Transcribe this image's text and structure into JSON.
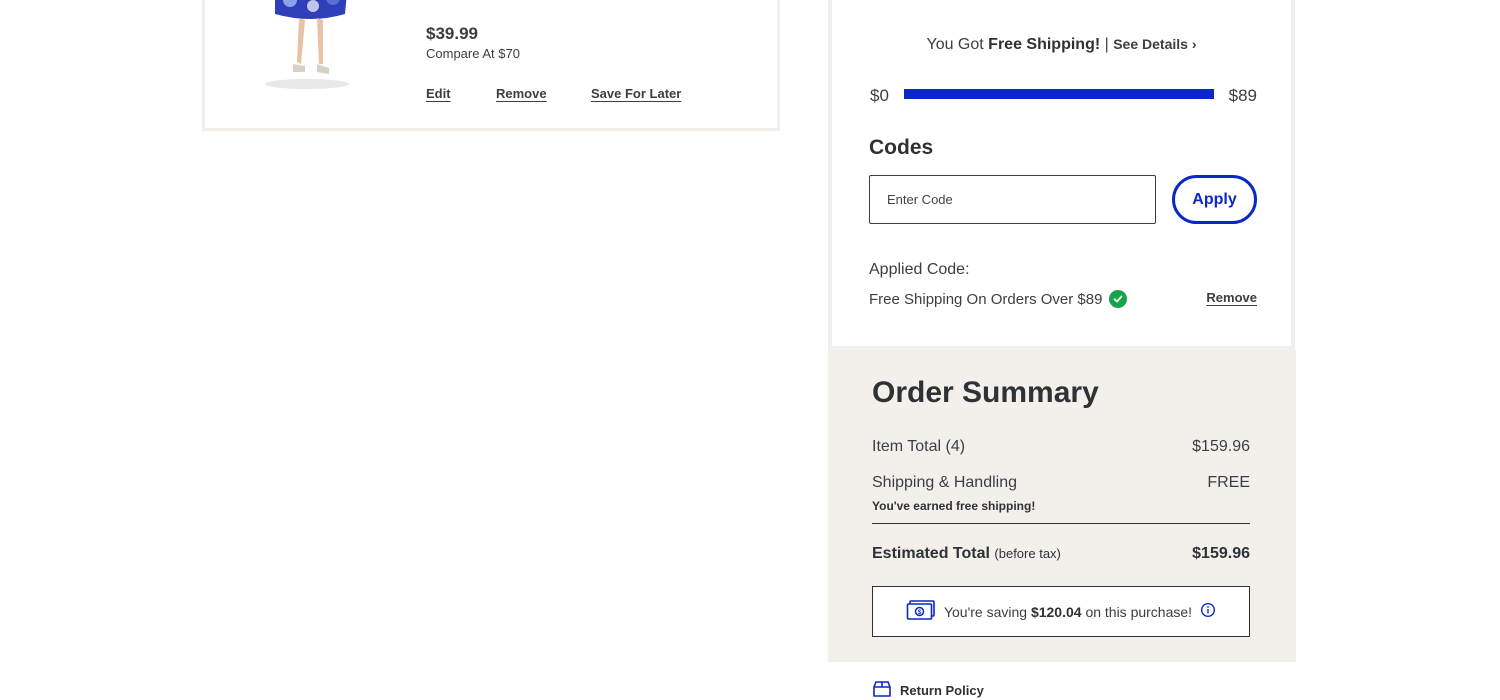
{
  "product": {
    "price": "$39.99",
    "compare_at": "Compare At $70",
    "edit_label": "Edit",
    "remove_label": "Remove",
    "save_later_label": "Save For Later"
  },
  "shipping": {
    "prefix": "You Got ",
    "emphasis": "Free Shipping!",
    "separator": " | ",
    "see_details": "See Details",
    "min": "$0",
    "max": "$89",
    "progress_percent": 100,
    "bar_color": "#0a27c7"
  },
  "codes": {
    "heading": "Codes",
    "placeholder": "Enter Code",
    "value": "",
    "apply_label": "Apply",
    "applied_label": "Applied Code:",
    "applied_code": "Free Shipping On Orders Over $89",
    "remove_label": "Remove"
  },
  "summary": {
    "title": "Order Summary",
    "item_total_label": "Item Total (4)",
    "item_total_value": "$159.96",
    "shipping_label": "Shipping & Handling",
    "shipping_value": "FREE",
    "shipping_note": "You've earned free shipping!",
    "estimated_label": "Estimated Total",
    "estimated_note": "(before tax)",
    "estimated_value": "$159.96",
    "savings_prefix": "You're saving",
    "savings_amount": "$120.04",
    "savings_suffix": "on this purchase!"
  },
  "footer": {
    "return_policy": "Return Policy"
  },
  "colors": {
    "accent": "#0a27c7",
    "success": "#16a34a",
    "summary_bg": "#f3f0ec"
  }
}
